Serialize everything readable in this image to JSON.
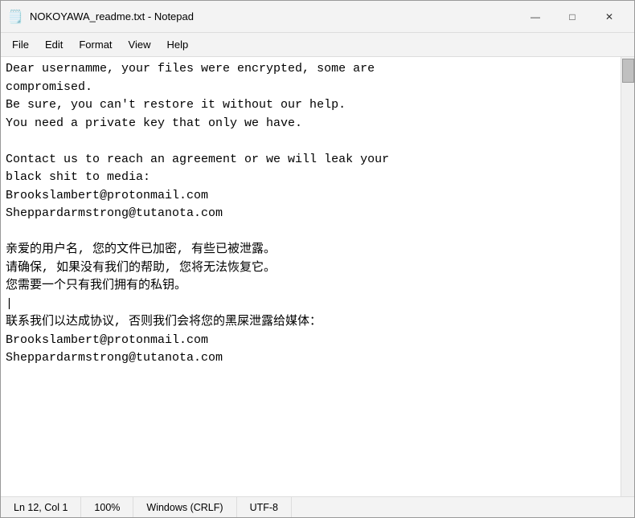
{
  "titleBar": {
    "icon": "📄",
    "title": "NOKOYAWA_readme.txt - Notepad",
    "minimizeLabel": "—",
    "maximizeLabel": "□",
    "closeLabel": "✕"
  },
  "menuBar": {
    "items": [
      "File",
      "Edit",
      "Format",
      "View",
      "Help"
    ]
  },
  "editor": {
    "content": "Dear usernamme, your files were encrypted, some are\ncompromised.\nBe sure, you can't restore it without our help.\nYou need a private key that only we have.\n\nContact us to reach an agreement or we will leak your\nblack shit to media:\nBrookslambert@protonmail.com\nSheppardarmstrong@tutanota.com\n\n亲爱的用户名, 您的文件已加密, 有些已被泄露。\n请确保, 如果没有我们的帮助, 您将无法恢复它。\n您需要一个只有我们拥有的私钥。\n|\n联系我们以达成协议, 否则我们会将您的黑屎泄露给媒体：\nBrookslambert@protonmail.com\nSheppardarmstrong@tutanota.com"
  },
  "statusBar": {
    "position": "Ln 12, Col 1",
    "zoom": "100%",
    "lineEnding": "Windows (CRLF)",
    "encoding": "UTF-8"
  }
}
